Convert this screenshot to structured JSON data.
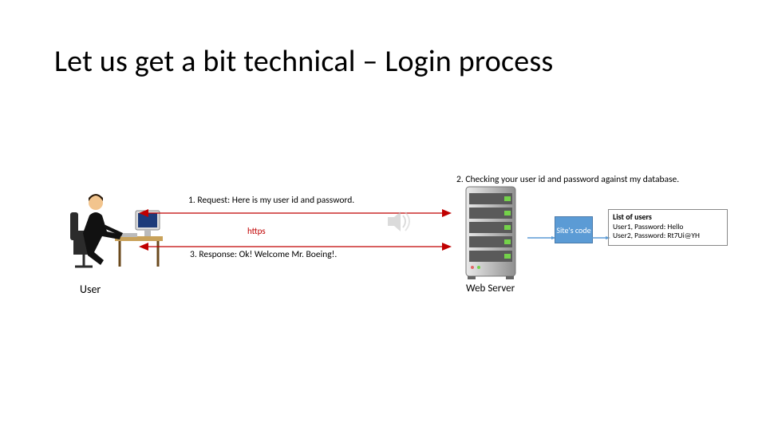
{
  "title": "Let us get a bit technical – Login process",
  "steps": {
    "s1": "1. Request: Here is my user id and password.",
    "s2": "2. Checking your user id and password against my database.",
    "s3": "3. Response: Ok! Welcome Mr. Boeing!."
  },
  "https_label": "https",
  "labels": {
    "user": "User",
    "server": "Web Server",
    "sitecode": "Site's code"
  },
  "userlist": {
    "header": "List of users",
    "row1": "User1, Password: Hello",
    "row2": "User2, Password: Rt7Ui@YH"
  },
  "colors": {
    "accent_blue": "#5B9BD5",
    "red": "#C00000",
    "green_light": "#74D24A"
  }
}
